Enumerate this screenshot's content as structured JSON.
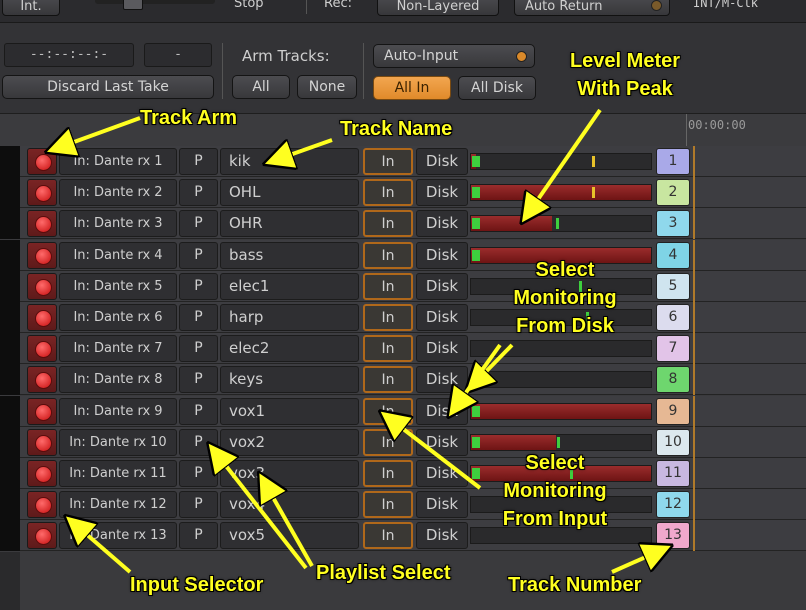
{
  "topbar": {
    "int_label": "Int.",
    "stop_label": "Stop",
    "rec_label": "Rec:",
    "rec_mode": "Non-Layered",
    "auto_return": "Auto Return",
    "clock_source": "INT/M-Clk"
  },
  "controls": {
    "timecode": "--:--:--:-",
    "take_field": "-",
    "discard_last_take": "Discard Last Take",
    "arm_tracks_label": "Arm Tracks:",
    "arm_all": "All",
    "arm_none": "None",
    "auto_input": "Auto-Input",
    "all_in": "All In",
    "all_disk": "All Disk"
  },
  "ruler": {
    "time": "00:00:00"
  },
  "tracks": [
    {
      "input": "In: Dante rx 1",
      "playlist": "P",
      "name": "kik",
      "monitor_in": "In",
      "monitor_disk": "Disk",
      "number": "1",
      "level": 0.03,
      "peak": 0.67,
      "peak_color": "#e8c22a",
      "color": "#a9a9e8"
    },
    {
      "input": "In: Dante rx 2",
      "playlist": "P",
      "name": "OHL",
      "monitor_in": "In",
      "monitor_disk": "Disk",
      "number": "2",
      "level": 1.0,
      "peak": 0.67,
      "peak_color": "#e8c22a",
      "color": "#c8e6a0"
    },
    {
      "input": "In: Dante rx 3",
      "playlist": "P",
      "name": "OHR",
      "monitor_in": "In",
      "monitor_disk": "Disk",
      "number": "3",
      "level": 0.45,
      "peak": 0.47,
      "peak_color": "#3ecf3e",
      "color": "#8fd8ec"
    },
    {
      "input": "In: Dante rx 4",
      "playlist": "P",
      "name": "bass",
      "monitor_in": "In",
      "monitor_disk": "Disk",
      "number": "4",
      "level": 1.0,
      "peak": 0.0,
      "peak_color": "#3ecf3e",
      "color": "#7fd4e6"
    },
    {
      "input": "In: Dante rx 5",
      "playlist": "P",
      "name": "elec1",
      "monitor_in": "In",
      "monitor_disk": "Disk",
      "number": "5",
      "level": 0.0,
      "peak": 0.6,
      "peak_color": "#3ecf3e",
      "color": "#cfe4ef"
    },
    {
      "input": "In: Dante rx 6",
      "playlist": "P",
      "name": "harp",
      "monitor_in": "In",
      "monitor_disk": "Disk",
      "number": "6",
      "level": 0.0,
      "peak": 0.64,
      "peak_color": "#3ecf3e",
      "color": "#dcdcee"
    },
    {
      "input": "In: Dante rx 7",
      "playlist": "P",
      "name": "elec2",
      "monitor_in": "In",
      "monitor_disk": "Disk",
      "number": "7",
      "level": 0.0,
      "peak": 0.0,
      "peak_color": "#3ecf3e",
      "color": "#e2c4e8"
    },
    {
      "input": "In: Dante rx 8",
      "playlist": "P",
      "name": "keys",
      "monitor_in": "In",
      "monitor_disk": "Disk",
      "number": "8",
      "level": 0.03,
      "peak": 0.0,
      "peak_color": "#3ecf3e",
      "color": "#6ed66e"
    },
    {
      "input": "In: Dante rx 9",
      "playlist": "P",
      "name": "vox1",
      "monitor_in": "In",
      "monitor_disk": "Disk",
      "number": "9",
      "level": 1.0,
      "peak": 0.0,
      "peak_color": "#3ecf3e",
      "color": "#e6b894"
    },
    {
      "input": "In: Dante rx 10",
      "playlist": "P",
      "name": "vox2",
      "monitor_in": "In",
      "monitor_disk": "Disk",
      "number": "10",
      "level": 0.47,
      "peak": 0.48,
      "peak_color": "#3ecf3e",
      "color": "#dce8ee"
    },
    {
      "input": "In: Dante rx 11",
      "playlist": "P",
      "name": "vox3",
      "monitor_in": "In",
      "monitor_disk": "Disk",
      "number": "11",
      "level": 1.0,
      "peak": 0.55,
      "peak_color": "#3ecf3e",
      "color": "#c8b8e0"
    },
    {
      "input": "In: Dante rx 12",
      "playlist": "P",
      "name": "vox4",
      "monitor_in": "In",
      "monitor_disk": "Disk",
      "number": "12",
      "level": 0.0,
      "peak": 0.0,
      "peak_color": "#3ecf3e",
      "color": "#8fd8ec"
    },
    {
      "input": "In: Dante rx 13",
      "playlist": "P",
      "name": "vox5",
      "monitor_in": "In",
      "monitor_disk": "Disk",
      "number": "13",
      "level": 0.0,
      "peak": 0.0,
      "peak_color": "#3ecf3e",
      "color": "#f0a8cc"
    }
  ],
  "annotations": {
    "track_arm": "Track Arm",
    "track_name": "Track Name",
    "level_meter": "Level Meter With Peak",
    "select_disk": "Select Monitoring From Disk",
    "select_input": "Select Monitoring From Input",
    "input_selector": "Input Selector",
    "playlist_select": "Playlist Select",
    "track_number": "Track Number"
  },
  "colors": {
    "accent": "#f0a040",
    "annotation": "#ffff20",
    "arm_red": "#d82a2a"
  }
}
